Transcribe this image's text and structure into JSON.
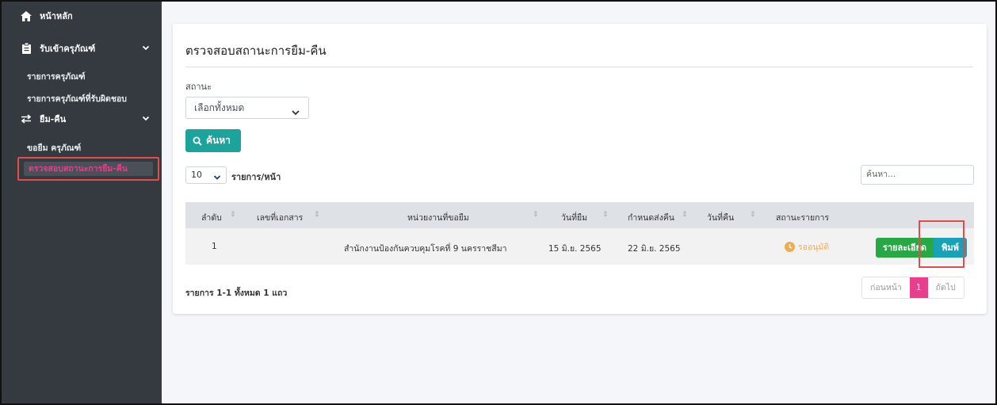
{
  "sidebar": {
    "home": "หน้าหลัก",
    "receive": "รับเข้าครุภัณฑ์",
    "receive_items": [
      "รายการครุภัณฑ์",
      "รายการครุภัณฑ์ที่รับผิดชอบ"
    ],
    "borrow": "ยืม-คืน",
    "borrow_items": [
      "ขอยืม ครุภัณฑ์",
      "ตรวจสอบสถานะการยืม-คืน"
    ]
  },
  "main": {
    "title": "ตรวจสอบสถานะการยืม-คืน",
    "status_label": "สถานะ",
    "status_value": "เลือกทั้งหมด",
    "search_button": "ค้นหา",
    "page_length": "10",
    "page_length_label": "รายการ/หน้า",
    "filter_placeholder": "ค้นหา...",
    "columns": [
      "ลำดับ",
      "เลขที่เอกสาร",
      "หน่วยงานที่ขอยืม",
      "วันที่ยืม",
      "กำหนดส่งคืน",
      "วันที่คืน",
      "สถานะรายการ"
    ],
    "rows": [
      {
        "no": "1",
        "doc_no": "",
        "agency": "สำนักงานป้องกันควบคุมโรคที่ 9 นครราชสีมา",
        "borrow_date": "15 มิ.ย. 2565",
        "due_date": "22 มิ.ย. 2565",
        "return_date": "",
        "status": "รออนุมัติ",
        "detail_label": "รายละเอียด",
        "print_label": "พิมพ์"
      }
    ],
    "summary": "รายการ 1-1 ทั้งหมด 1 แถว",
    "pager": {
      "prev": "ก่อนหน้า",
      "current": "1",
      "next": "ถัดไป"
    }
  },
  "colors": {
    "sidebar_bg": "#343a40",
    "accent_teal": "#1ba39c",
    "active_pink": "#e83e8c",
    "success_green": "#28a745",
    "info_cyan": "#17a2b8",
    "pending_orange": "#f0ad4e",
    "highlight_red": "#e54b4b"
  }
}
